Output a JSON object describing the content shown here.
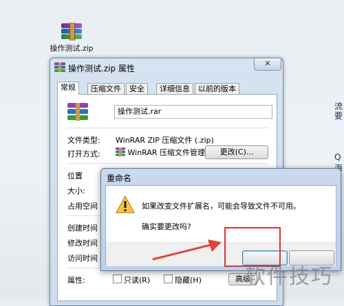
{
  "desktop": {
    "icon_label": "操作测试.zip",
    "edge_texts": [
      "流",
      "要",
      "Q",
      "海"
    ]
  },
  "properties_window": {
    "title": "操作测试.zip 属性",
    "close_glyph": "✕",
    "tabs": [
      "常规",
      "压缩文件",
      "安全",
      "详细信息",
      "以前的版本"
    ],
    "file_name": "操作测试.rar",
    "rows": {
      "type_label": "文件类型:",
      "type_value": "WinRAR ZIP 压缩文件 (.zip)",
      "open_label": "打开方式:",
      "open_value": "WinRAR 压缩文件管理",
      "change_button": "更改(C)...",
      "location_label": "位置",
      "size_label": "大小:",
      "disk_label": "占用空间",
      "created_label": "创建时间",
      "modified_label": "修改时间",
      "accessed_label": "访问时间",
      "attributes_label": "属性:",
      "readonly_label": "只读(R)",
      "hidden_label": "隐藏(H)",
      "advanced_button": "高级"
    }
  },
  "rename_dialog": {
    "title": "重命名",
    "warning": "如果改变文件扩展名，可能会导致文件不可用。",
    "confirm": "确实要更改吗?",
    "yes_button": "",
    "no_button": ""
  },
  "watermark": "软件技巧",
  "colors": {
    "highlight": "#d8352f",
    "arrow": "#e0443d"
  }
}
